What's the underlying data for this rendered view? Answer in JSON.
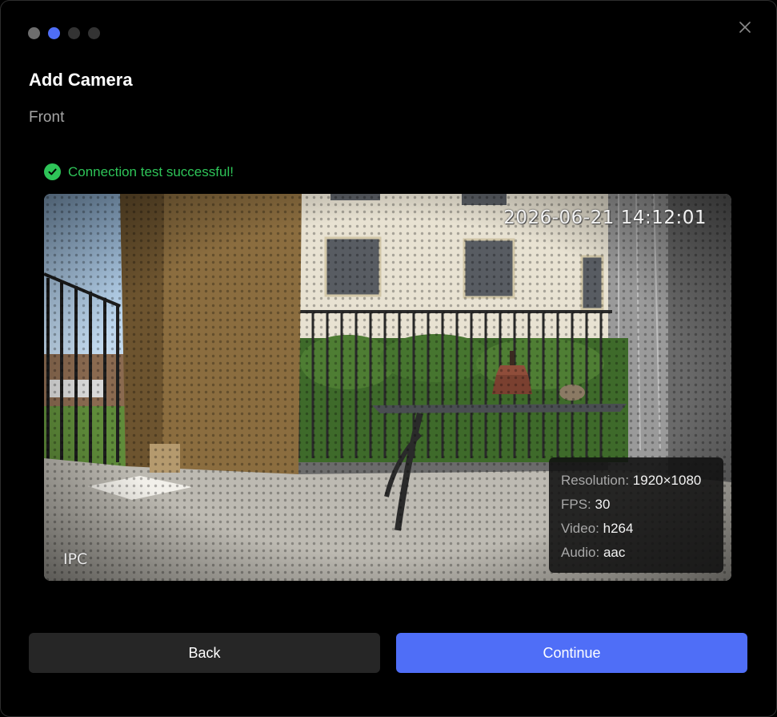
{
  "wizard": {
    "steps": [
      {
        "state": "done"
      },
      {
        "state": "active"
      },
      {
        "state": "pending"
      },
      {
        "state": "pending"
      }
    ],
    "close_icon": "close-icon"
  },
  "header": {
    "title": "Add Camera",
    "subtitle": "Front"
  },
  "status": {
    "icon": "check-circle-icon",
    "text": "Connection test successful!",
    "color": "#2ec458"
  },
  "preview": {
    "timestamp": "2026-06-21 14:12:01",
    "camera_label": "IPC",
    "info": [
      {
        "label": "Resolution:",
        "value": "1920×1080"
      },
      {
        "label": "FPS:",
        "value": "30"
      },
      {
        "label": "Video:",
        "value": "h264"
      },
      {
        "label": "Audio:",
        "value": "aac"
      }
    ]
  },
  "actions": {
    "back_label": "Back",
    "continue_label": "Continue"
  },
  "colors": {
    "accent": "#4f6ef7",
    "success": "#2ec458",
    "background": "#000000",
    "secondary_button": "#262626"
  }
}
